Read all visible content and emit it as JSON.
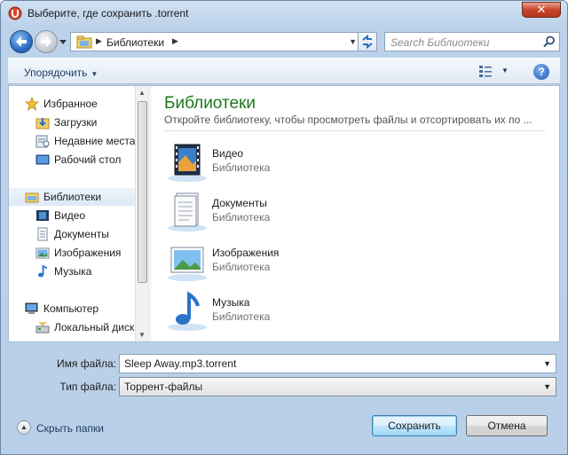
{
  "window": {
    "title": "Выберите, где сохранить .torrent",
    "close_label": "✕",
    "app_icon": "utorrent-icon"
  },
  "navigation": {
    "address_crumb": "Библиотеки",
    "search_placeholder": "Search Библиотеки"
  },
  "toolbar": {
    "organize_label": "Упорядочить",
    "help_label": "?"
  },
  "sidebar": {
    "items": [
      {
        "label": "Избранное",
        "icon": "star-icon"
      },
      {
        "label": "Загрузки",
        "icon": "downloads-folder-icon"
      },
      {
        "label": "Недавние места",
        "icon": "recent-places-icon"
      },
      {
        "label": "Рабочий стол",
        "icon": "desktop-icon"
      },
      {
        "label": "Библиотеки",
        "icon": "libraries-icon",
        "selected": true
      },
      {
        "label": "Видео",
        "icon": "video-library-icon"
      },
      {
        "label": "Документы",
        "icon": "documents-library-icon"
      },
      {
        "label": "Изображения",
        "icon": "pictures-library-icon"
      },
      {
        "label": "Музыка",
        "icon": "music-library-icon"
      },
      {
        "label": "Компьютер",
        "icon": "computer-icon"
      },
      {
        "label": "Локальный диск",
        "icon": "local-disk-icon"
      }
    ]
  },
  "content": {
    "title": "Библиотеки",
    "subtitle": "Откройте библиотеку, чтобы просмотреть файлы и отсортировать их по ...",
    "libraries": [
      {
        "name": "Видео",
        "type": "Библиотека",
        "icon": "video-library-icon"
      },
      {
        "name": "Документы",
        "type": "Библиотека",
        "icon": "documents-library-icon"
      },
      {
        "name": "Изображения",
        "type": "Библиотека",
        "icon": "pictures-library-icon"
      },
      {
        "name": "Музыка",
        "type": "Библиотека",
        "icon": "music-library-icon"
      }
    ]
  },
  "form": {
    "filename_label": "Имя файла:",
    "filename_value": "Sleep Away.mp3.torrent",
    "filetype_label": "Тип файла:",
    "filetype_value": "Торрент-файлы"
  },
  "footer": {
    "hide_folders_label": "Скрыть папки",
    "save_label": "Сохранить",
    "cancel_label": "Отмена"
  }
}
